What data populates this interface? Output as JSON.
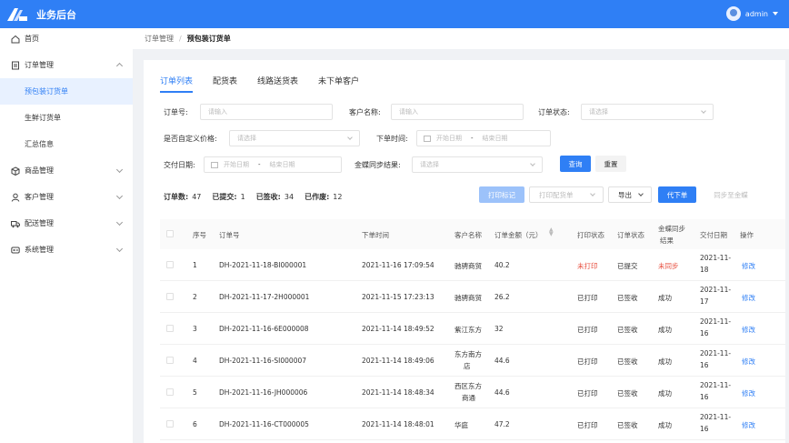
{
  "app": {
    "title": "业务后台",
    "user": "admin",
    "accent": "#2f7ff5"
  },
  "sidebar": {
    "items": [
      {
        "label": "首页",
        "icon": "home-icon"
      },
      {
        "label": "订单管理",
        "icon": "order-icon",
        "expanded": true,
        "children": [
          {
            "label": "预包装订货单",
            "active": true
          },
          {
            "label": "生鲜订货单"
          },
          {
            "label": "汇总信息"
          }
        ]
      },
      {
        "label": "商品管理",
        "icon": "box-icon"
      },
      {
        "label": "客户管理",
        "icon": "user-icon"
      },
      {
        "label": "配送管理",
        "icon": "truck-icon"
      },
      {
        "label": "系统管理",
        "icon": "system-icon"
      }
    ]
  },
  "breadcrumb": {
    "parent": "订单管理",
    "sep": "/",
    "current": "预包装订货单"
  },
  "tabs": [
    "订单列表",
    "配货表",
    "线路送货表",
    "未下单客户"
  ],
  "filters": {
    "order_no": {
      "label": "订单号:",
      "placeholder": "请输入"
    },
    "customer": {
      "label": "客户名称:",
      "placeholder": "请输入"
    },
    "status": {
      "label": "订单状态:",
      "placeholder": "请选择"
    },
    "custom_price": {
      "label": "是否自定义价格:",
      "placeholder": "请选择"
    },
    "order_time": {
      "label": "下单时间:",
      "start": "开始日期",
      "dash": "-",
      "end": "结束日期"
    },
    "delivery_date": {
      "label": "交付日期:",
      "start": "开始日期",
      "dash": "-",
      "end": "结束日期"
    },
    "sync_result": {
      "label": "金蝶同步结果:",
      "placeholder": "请选择"
    },
    "query": "查询",
    "reset": "重置"
  },
  "stats": [
    {
      "label": "订单数:",
      "value": "47"
    },
    {
      "label": "已提交:",
      "value": "1"
    },
    {
      "label": "已签收:",
      "value": "34"
    },
    {
      "label": "已作废:",
      "value": "12"
    }
  ],
  "toolbar": {
    "print_mark": "打印标记",
    "print_dispatch": "打印配货单",
    "export": "导出",
    "place_order": "代下单",
    "sync_all": "同步至金蝶"
  },
  "table": {
    "headers": {
      "seq": "序号",
      "order_no": "订单号",
      "order_time": "下单时间",
      "customer": "客户名称",
      "amount": "订单金额（元）",
      "print_status": "打印状态",
      "order_status": "订单状态",
      "sync_line1": "金蝶同步",
      "sync_line2": "结果",
      "delivery": "交付日期",
      "action": "操作"
    },
    "rows": [
      {
        "seq": "1",
        "order_no": "DH-2021-11-18-BI000001",
        "time": "2021-11-16 17:09:54",
        "customer": "驰骋商贸",
        "customer2": "",
        "amount": "40.2",
        "print": "未打印",
        "status": "已提交",
        "sync": "未同步",
        "d1": "2021-11-",
        "d2": "18",
        "action": "修改"
      },
      {
        "seq": "2",
        "order_no": "DH-2021-11-17-2H000001",
        "time": "2021-11-15 17:23:13",
        "customer": "驰骋商贸",
        "customer2": "",
        "amount": "26.2",
        "print": "已打印",
        "status": "已签收",
        "sync": "成功",
        "d1": "2021-11-",
        "d2": "17",
        "action": "修改"
      },
      {
        "seq": "3",
        "order_no": "DH-2021-11-16-6E000008",
        "time": "2021-11-14 18:49:52",
        "customer": "紫江东方",
        "customer2": "",
        "amount": "32",
        "print": "已打印",
        "status": "已签收",
        "sync": "成功",
        "d1": "2021-11-",
        "d2": "16",
        "action": "修改"
      },
      {
        "seq": "4",
        "order_no": "DH-2021-11-16-SI000007",
        "time": "2021-11-14 18:49:06",
        "customer": "东方南方",
        "customer2": "店",
        "amount": "44.6",
        "print": "已打印",
        "status": "已签收",
        "sync": "成功",
        "d1": "2021-11-",
        "d2": "16",
        "action": "修改"
      },
      {
        "seq": "5",
        "order_no": "DH-2021-11-16-JH000006",
        "time": "2021-11-14 18:48:34",
        "customer": "西区东方",
        "customer2": "商通",
        "amount": "44.6",
        "print": "已打印",
        "status": "已签收",
        "sync": "成功",
        "d1": "2021-11-",
        "d2": "16",
        "action": "修改"
      },
      {
        "seq": "6",
        "order_no": "DH-2021-11-16-CT000005",
        "time": "2021-11-14 18:48:01",
        "customer": "华庭",
        "customer2": "",
        "amount": "47.2",
        "print": "已打印",
        "status": "已签收",
        "sync": "成功",
        "d1": "2021-11-",
        "d2": "16",
        "action": "修改"
      }
    ]
  }
}
